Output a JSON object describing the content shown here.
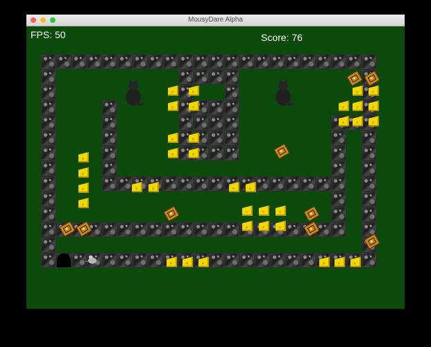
{
  "window": {
    "title": "MousyDare Alpha"
  },
  "hud": {
    "fps": "FPS: 50",
    "score": "Score: 76"
  },
  "colors": {
    "background": "#000000",
    "playfield": "#0b4a0b",
    "cheese": "#f0d800",
    "trap": "#c8871a",
    "wall": "#2a2a2a"
  },
  "sprites": [
    "stone-wall",
    "cheese",
    "mousetrap",
    "cat",
    "mouse",
    "mouse-hole"
  ]
}
